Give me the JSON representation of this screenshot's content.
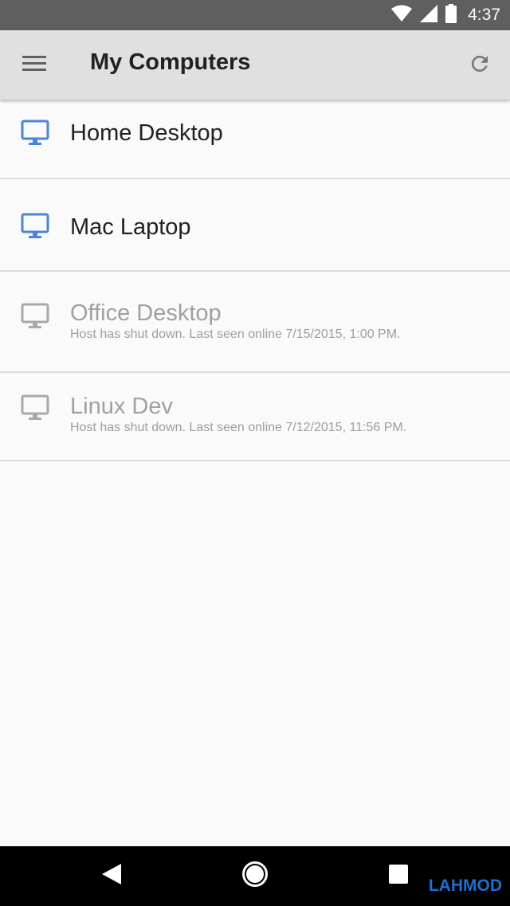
{
  "status_bar": {
    "time": "4:37",
    "icons": [
      "wifi-icon",
      "signal-icon",
      "battery-icon"
    ]
  },
  "app_bar": {
    "title": "My Computers",
    "menu_icon": "menu-icon",
    "refresh_icon": "refresh-icon"
  },
  "hosts": [
    {
      "name": "Home Desktop",
      "status": "",
      "online": true
    },
    {
      "name": "Mac Laptop",
      "status": "",
      "online": true
    },
    {
      "name": "Office Desktop",
      "status": "Host has shut down. Last seen online 7/15/2015, 1:00 PM.",
      "online": false
    },
    {
      "name": "Linux Dev",
      "status": "Host has shut down. Last seen online 7/12/2015, 11:56 PM.",
      "online": false
    }
  ],
  "nav_bar": {
    "back_icon": "back-icon",
    "home_icon": "home-icon",
    "recents_icon": "recents-icon",
    "watermark": "LAHMOD"
  },
  "colors": {
    "online_icon": "#4a86d8",
    "offline_icon": "#a8a8a8",
    "app_bar": "#e0e0e0",
    "status_bar": "#5f5f5f"
  }
}
